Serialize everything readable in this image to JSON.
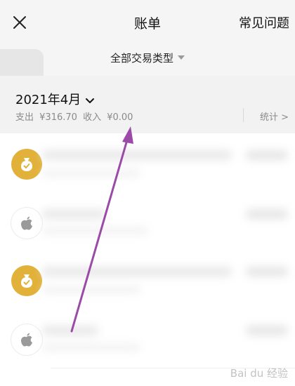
{
  "header": {
    "title": "账单",
    "faq_label": "常见问题",
    "close_icon": "close-icon"
  },
  "filter": {
    "label": "全部交易类型",
    "caret_icon": "caret-down-icon"
  },
  "summary": {
    "month": "2021年4月",
    "expense_label": "支出",
    "expense_value": "¥316.70",
    "income_label": "收入",
    "income_value": "¥0.00",
    "stats_label": "统计",
    "stats_chevron": ">"
  },
  "transactions": [
    {
      "icon": "money-bag-icon",
      "style": "gold"
    },
    {
      "icon": "apple-icon",
      "style": "white"
    },
    {
      "icon": "money-bag-icon",
      "style": "gold"
    },
    {
      "icon": "apple-icon",
      "style": "white"
    }
  ],
  "colors": {
    "header_bg": "#f5f5f5",
    "summary_bg": "#f2f2f2",
    "gold": "#e2b13a",
    "annotation_arrow": "#9b4aa8",
    "muted_text": "#8a8a8a"
  },
  "watermark": "Bai du 经验"
}
